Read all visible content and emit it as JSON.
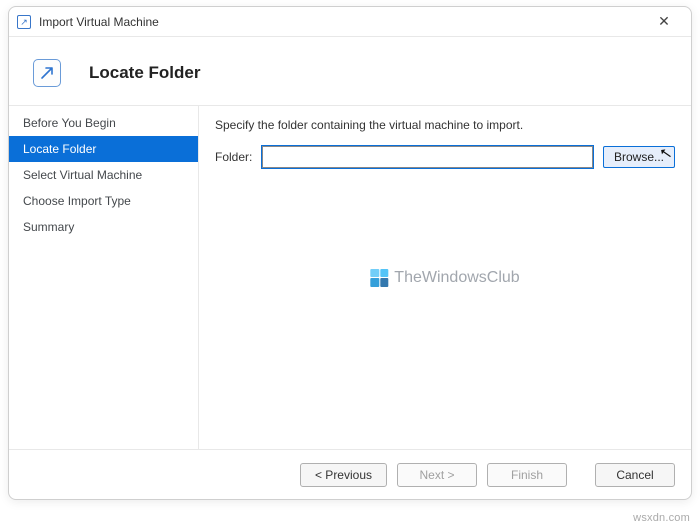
{
  "window": {
    "title": "Import Virtual Machine",
    "close_symbol": "✕"
  },
  "header": {
    "heading": "Locate Folder"
  },
  "sidebar": {
    "steps": [
      {
        "label": "Before You Begin",
        "active": false
      },
      {
        "label": "Locate Folder",
        "active": true
      },
      {
        "label": "Select Virtual Machine",
        "active": false
      },
      {
        "label": "Choose Import Type",
        "active": false
      },
      {
        "label": "Summary",
        "active": false
      }
    ]
  },
  "content": {
    "instruction": "Specify the folder containing the virtual machine to import.",
    "folder_label": "Folder:",
    "folder_value": "",
    "browse_label": "Browse..."
  },
  "watermark": {
    "text": "TheWindowsClub"
  },
  "footer": {
    "previous": "< Previous",
    "next": "Next >",
    "finish": "Finish",
    "cancel": "Cancel"
  },
  "page_credit": "wsxdn.com"
}
